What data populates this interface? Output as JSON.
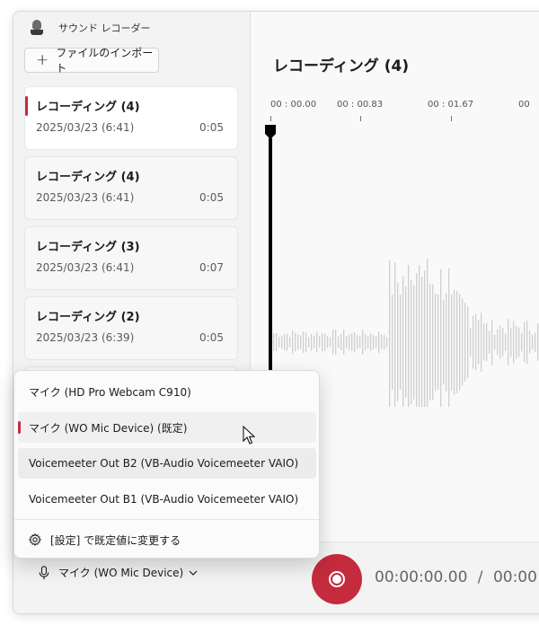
{
  "app": {
    "title": "サウンド レコーダー"
  },
  "sidebar": {
    "import_label": "ファイルのインポート",
    "recordings": [
      {
        "name": "レコーディング (4)",
        "date": "2025/03/23 (6:41)",
        "duration": "0:05",
        "selected": true
      },
      {
        "name": "レコーディング (4)",
        "date": "2025/03/23 (6:41)",
        "duration": "0:05"
      },
      {
        "name": "レコーディング (3)",
        "date": "2025/03/23 (6:41)",
        "duration": "0:07"
      },
      {
        "name": "レコーディング (2)",
        "date": "2025/03/23 (6:39)",
        "duration": "0:05"
      }
    ]
  },
  "main": {
    "title": "レコーディング (4)",
    "timeline_ticks": [
      "00 : 00.00",
      "00 : 00.83",
      "00 : 01.67",
      "00"
    ]
  },
  "dropdown": {
    "items": [
      {
        "label": "マイク (HD Pro Webcam C910)"
      },
      {
        "label": "マイク (WO Mic Device) (既定)",
        "selected": true
      },
      {
        "label": "Voicemeeter Out B2 (VB-Audio Voicemeeter VAIO)",
        "hovered": true
      },
      {
        "label": "Voicemeeter Out B1 (VB-Audio Voicemeeter VAIO)"
      }
    ],
    "settings_label": "[設定] で既定値に変更する"
  },
  "bottom": {
    "mic_label": "マイク (WO Mic Device)",
    "time_current": "00:00:00.00",
    "time_separator": "/",
    "time_total": "00:00"
  },
  "colors": {
    "accent": "#c42b3c"
  }
}
